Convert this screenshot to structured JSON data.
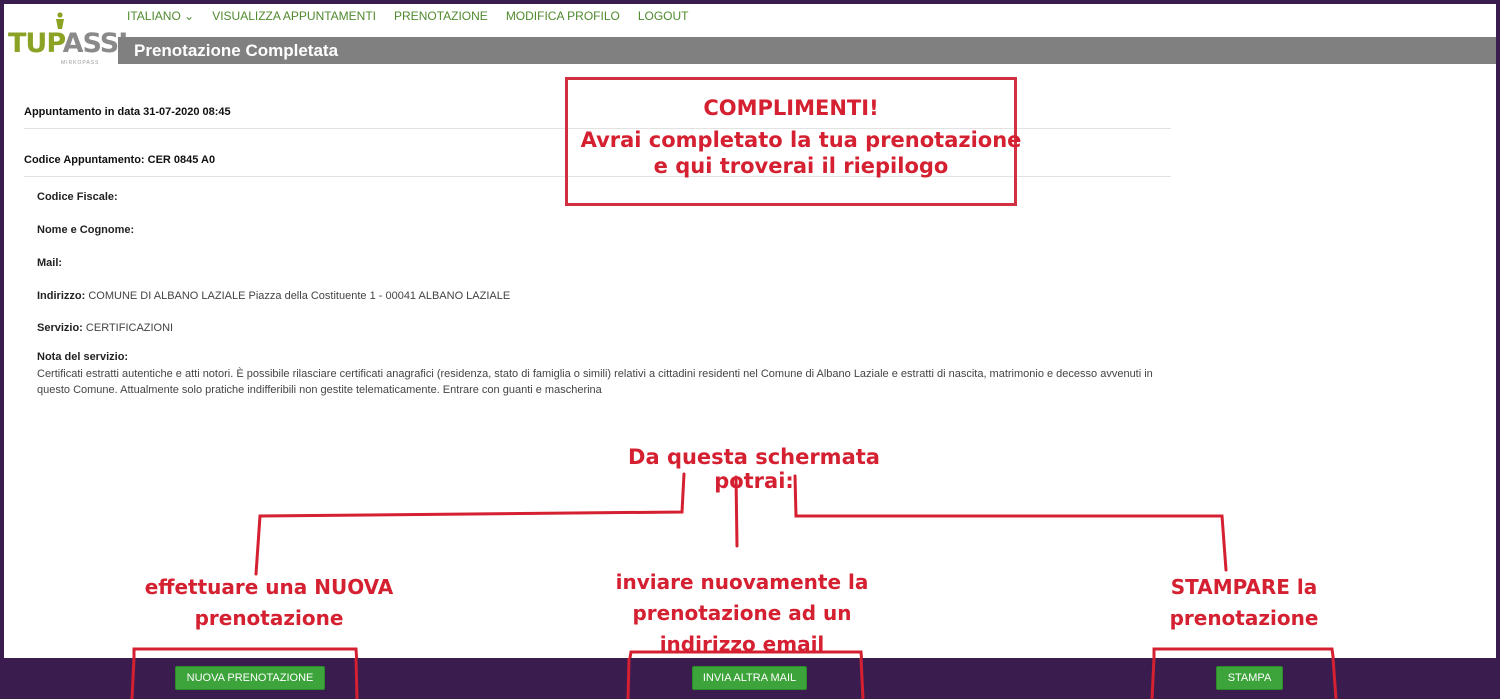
{
  "logo": {
    "word_green": "TUP",
    "word_gray": "ASSI",
    "sub": "MIRKOPASS"
  },
  "nav": {
    "language": "ITALIANO",
    "items": [
      "VISUALIZZA APPUNTAMENTI",
      "PRENOTAZIONE",
      "MODIFICA PROFILO",
      "LOGOUT"
    ]
  },
  "page_title": "Prenotazione Completata",
  "appointment": {
    "date_line": "Appuntamento in data 31-07-2020 08:45",
    "code_line": "Codice Appuntamento: CER 0845 A0"
  },
  "fields": {
    "codice_fiscale_label": "Codice Fiscale:",
    "nome_label": "Nome e Cognome:",
    "mail_label": "Mail:",
    "indirizzo_label": "Indirizzo:",
    "indirizzo_value": "COMUNE DI ALBANO LAZIALE Piazza della Costituente 1 - 00041 ALBANO LAZIALE",
    "servizio_label": "Servizio:",
    "servizio_value": "CERTIFICAZIONI",
    "nota_label": "Nota del servizio:",
    "nota_value": "Certificati estratti autentiche e atti notori. È possibile rilasciare certificati anagrafici (residenza, stato di famiglia o simili) relativi a cittadini residenti nel Comune di Albano Laziale e estratti di nascita, matrimonio e decesso avvenuti in questo Comune. Attualmente solo pratiche indifferibili non gestite telematicamente. Entrare con guanti e mascherina"
  },
  "annotations": {
    "compliments_1": "COMPLIMENTI!",
    "compliments_2": "Avrai completato la tua prenotazione",
    "compliments_3": "e qui troverai il riepilogo",
    "from_here": "Da questa schermata potrai:",
    "left_1": "effettuare una NUOVA",
    "left_2": "prenotazione",
    "mid_1": "inviare nuovamente la",
    "mid_2": "prenotazione ad un",
    "mid_3": "indirizzo email",
    "right_1": "STAMPARE la",
    "right_2": "prenotazione"
  },
  "buttons": {
    "new_booking": "NUOVA PRENOTAZIONE",
    "send_mail": "INVIA ALTRA MAIL",
    "print": "STAMPA"
  },
  "colors": {
    "nav_green": "#4f8a2e",
    "button_green": "#3ca43a",
    "annotation_red": "#d42030",
    "bar_purple": "#3a1d4e"
  }
}
